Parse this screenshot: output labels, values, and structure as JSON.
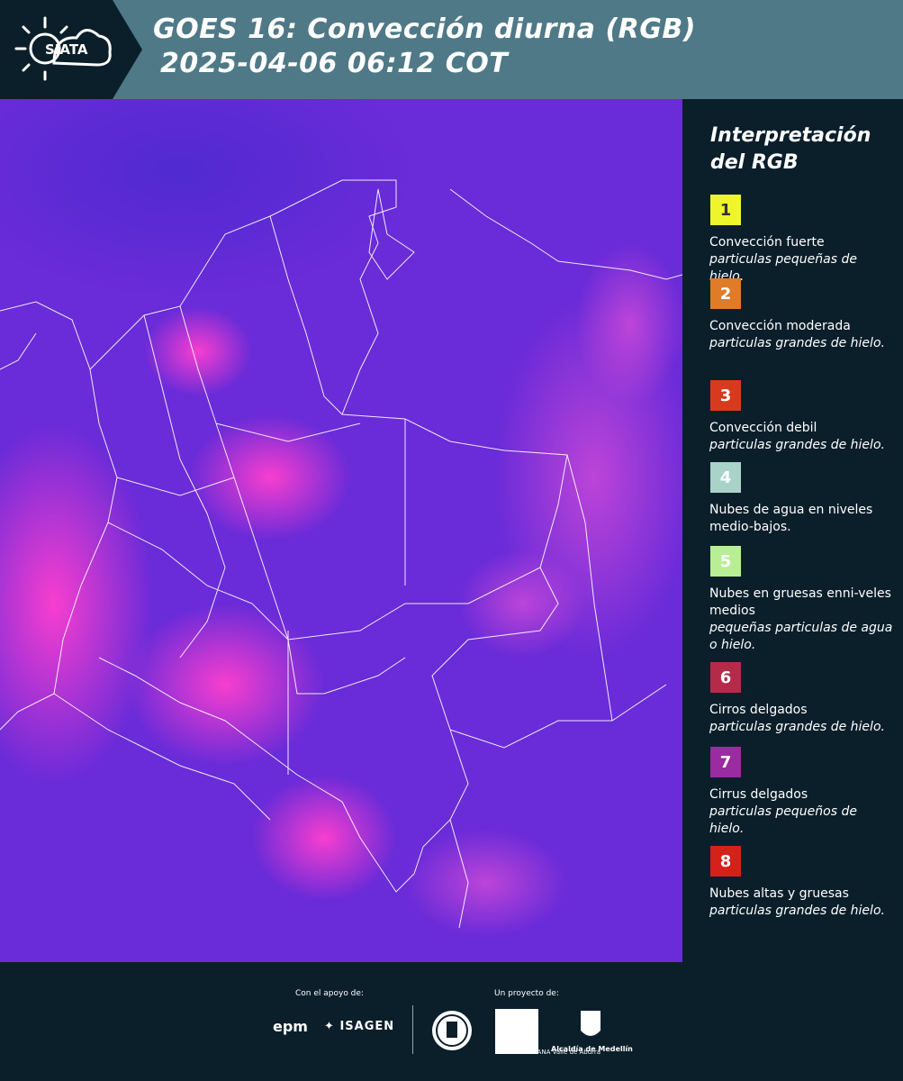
{
  "header": {
    "logo_text": "SIATA",
    "title_line1": "GOES 16: Convección diurna (RGB)",
    "title_line2": "2025-04-06 06:12 COT",
    "background": "#4f7987"
  },
  "map": {
    "description_colors": {
      "base": "#6a2bd8",
      "convection": "#ff3fcf",
      "borders": "#ffffff"
    }
  },
  "legend": {
    "title": "Interpretación del RGB",
    "items": [
      {
        "number": "1",
        "color": "#eef52a",
        "name": "Convección fuerte",
        "desc": "particulas pequeñas de hielo."
      },
      {
        "number": "2",
        "color": "#e07b28",
        "name": "Convección moderada",
        "desc": "particulas grandes de hielo."
      },
      {
        "number": "3",
        "color": "#d83a1e",
        "name": "Convección debil",
        "desc": "particulas grandes de hielo."
      },
      {
        "number": "4",
        "color": "#a9d3c8",
        "name": "Nubes de agua en niveles medio-bajos.",
        "desc": ""
      },
      {
        "number": "5",
        "color": "#b9ef94",
        "name": "Nubes en gruesas enni-veles medios",
        "desc": "pequeñas particulas de agua o hielo."
      },
      {
        "number": "6",
        "color": "#b42b4a",
        "name": "Cirros delgados",
        "desc": "particulas grandes de hielo."
      },
      {
        "number": "7",
        "color": "#9a2ba0",
        "name": "Cirrus delgados",
        "desc": "particulas pequeños de hielo."
      },
      {
        "number": "8",
        "color": "#d4211a",
        "name": "Nubes altas y gruesas",
        "desc": "particulas grandes de hielo."
      }
    ]
  },
  "footer": {
    "support_label": "Con el apoyo de:",
    "project_label": "Un proyecto de:",
    "epm": "epm",
    "isagen": "ISAGEN",
    "area_text": "METROPOLITANA Valle de Aburrá",
    "alcaldia": "Alcaldía de Medellín"
  }
}
